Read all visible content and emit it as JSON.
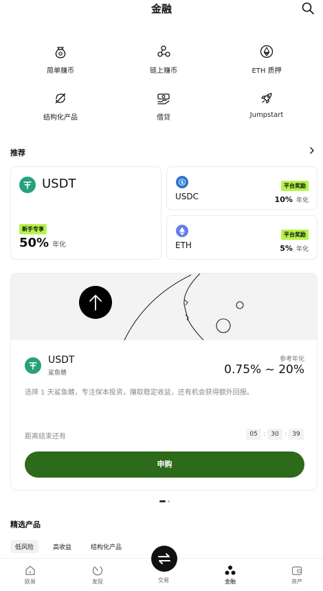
{
  "header": {
    "title": "金融",
    "search_icon": "search-icon"
  },
  "grid": [
    {
      "label": "简单赚币",
      "icon": "money-bag-icon"
    },
    {
      "label": "链上赚币",
      "icon": "onchain-nodes-icon"
    },
    {
      "label": "ETH 质押",
      "icon": "eth-staking-icon"
    },
    {
      "label": "结构化产品",
      "icon": "structured-product-icon"
    },
    {
      "label": "借贷",
      "icon": "loan-icon"
    },
    {
      "label": "Jumpstart",
      "icon": "rocket-icon"
    }
  ],
  "recommend": {
    "title": "推荐",
    "big": {
      "coin": "USDT",
      "badge": "新手专享",
      "rate": "50%",
      "unit": "年化",
      "coin_color": "#26a17b"
    },
    "small": [
      {
        "coin": "USDC",
        "badge": "平台奖励",
        "rate": "10%",
        "unit": "年化",
        "coin_color": "#2775ca"
      },
      {
        "coin": "ETH",
        "badge": "平台奖励",
        "rate": "5%",
        "unit": "年化",
        "coin_color": "#627eea"
      }
    ]
  },
  "feature": {
    "coin": "USDT",
    "product": "鲨鱼鳍",
    "rate_label": "参考年化",
    "rate": "0.75% ~ 20%",
    "desc": "选择 1 天鲨鱼鳍，专注保本投资，赚取稳定收益，还有机会获得额外回报。",
    "countdown_label": "距离结束还有",
    "countdown": [
      "05",
      "30",
      "39"
    ],
    "sep": ":",
    "button": "申购",
    "accent": "#2d6a1a"
  },
  "featured": {
    "title": "精选产品",
    "chips": [
      "低风险",
      "高收益",
      "结构化产品"
    ]
  },
  "tabs": [
    {
      "label": "欧易",
      "icon": "home-icon",
      "active": false
    },
    {
      "label": "发现",
      "icon": "discover-icon",
      "active": false
    },
    {
      "label": "交易",
      "icon": "trade-icon",
      "active": false
    },
    {
      "label": "金融",
      "icon": "finance-icon",
      "active": true
    },
    {
      "label": "资产",
      "icon": "wallet-icon",
      "active": false
    }
  ]
}
